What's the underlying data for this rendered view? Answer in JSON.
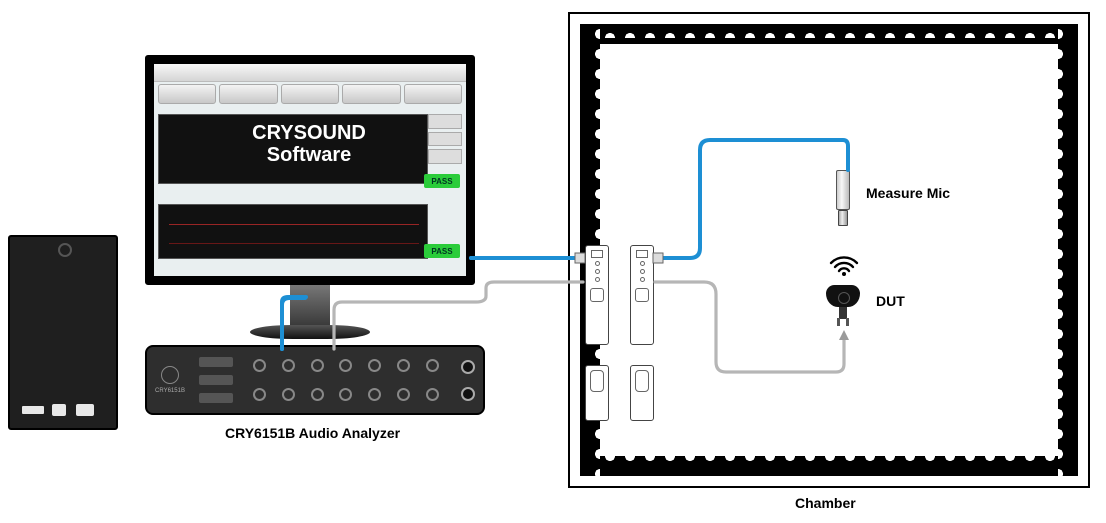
{
  "software": {
    "title_line1": "CRYSOUND",
    "title_line2": "Software",
    "pass_badge": "PASS"
  },
  "labels": {
    "analyzer": "CRY6151B Audio Analyzer",
    "chamber": "Chamber",
    "measure_mic": "Measure Mic",
    "dut": "DUT"
  },
  "analyzer": {
    "model": "CRY6151B"
  },
  "colors": {
    "cable_signal": "#1d8fd4",
    "cable_ctrl": "#b6b6b6"
  }
}
